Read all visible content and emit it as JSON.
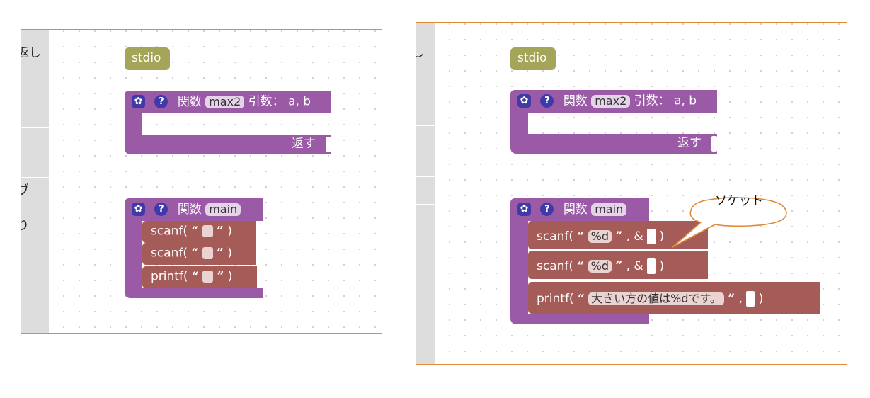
{
  "left_panel": {
    "toolbox_labels": [
      "返し",
      "]",
      "ヷ",
      "り"
    ],
    "stdio_label": "stdio",
    "func1": {
      "keyword": "関数",
      "name": "max2",
      "args_label": "引数：",
      "args": "a, b",
      "return_label": "返す"
    },
    "func2": {
      "keyword": "関数",
      "name": "main"
    },
    "statements": [
      {
        "fn": "scanf(",
        "open_q": "“",
        "close_q": "”",
        "end": ")"
      },
      {
        "fn": "scanf(",
        "open_q": "“",
        "close_q": "”",
        "end": ")"
      },
      {
        "fn": "printf(",
        "open_q": "“",
        "close_q": "”",
        "end": ")"
      }
    ]
  },
  "right_panel": {
    "toolbox_labels": [
      "し"
    ],
    "stdio_label": "stdio",
    "func1": {
      "keyword": "関数",
      "name": "max2",
      "args_label": "引数：",
      "args": "a, b",
      "return_label": "返す"
    },
    "func2": {
      "keyword": "関数",
      "name": "main"
    },
    "statements": [
      {
        "fn": "scanf(",
        "open_q": "“",
        "format": "%d",
        "close_q": "”",
        "sep": ", &",
        "end": ")"
      },
      {
        "fn": "scanf(",
        "open_q": "“",
        "format": "%d",
        "close_q": "”",
        "sep": ", &",
        "end": ")"
      },
      {
        "fn": "printf(",
        "open_q": "“",
        "format": "大きい方の値は%dです。",
        "close_q": "”",
        "sep": ",",
        "end": ")"
      }
    ],
    "callout": "ソケット"
  },
  "colors": {
    "function_block": "#9a5aa6",
    "statement_block": "#a55b57",
    "stdio_block": "#a5a55a",
    "panel_border": "#e08a3a",
    "callout_border": "#e08a3a"
  },
  "icons": [
    "gear-icon",
    "help-icon"
  ]
}
